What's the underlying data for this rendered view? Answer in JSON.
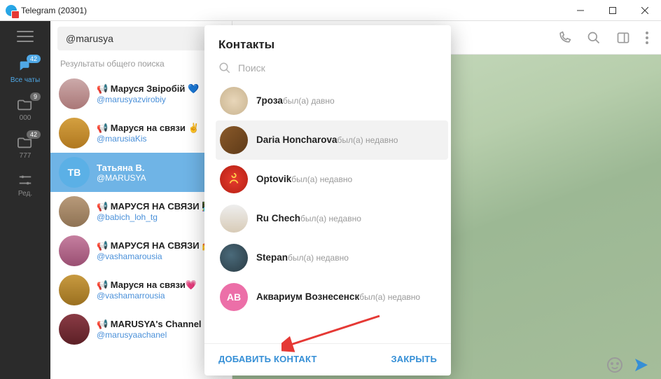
{
  "window": {
    "title": "Telegram (20301)"
  },
  "rail": {
    "items": [
      {
        "label": "Все чаты",
        "badge": "42"
      },
      {
        "label": "000",
        "badge": "9"
      },
      {
        "label": "777",
        "badge": "42"
      },
      {
        "label": "Ред."
      }
    ]
  },
  "search": {
    "value": "@marusya",
    "results_header": "Результаты общего поиска"
  },
  "chats": [
    {
      "name": "📢 Маруся Звіробій 💙",
      "user": "@marusyazvirobiy"
    },
    {
      "name": "📢 Маруся на связи ✌️",
      "user": "@marusiaKis"
    },
    {
      "name": "Татьяна В.",
      "user": "@MARUSYA",
      "selected": true,
      "initials": "ТВ"
    },
    {
      "name": "📢 МАРУСЯ НА СВЯЗИ 👩‍💻",
      "user": "@babich_loh_tg"
    },
    {
      "name": "📢 МАРУСЯ НА СВЯЗИ 💅",
      "user": "@vashamarousia"
    },
    {
      "name": "📢 Маруся на связи💗",
      "user": "@vashamarrousia"
    },
    {
      "name": "📢 MARUSYA's Channel",
      "user": "@marusyaachanel"
    }
  ],
  "modal": {
    "title": "Контакты",
    "search_placeholder": "Поиск",
    "add_label": "ДОБАВИТЬ КОНТАКТ",
    "close_label": "ЗАКРЫТЬ",
    "contacts": [
      {
        "name": "7роза",
        "status": "был(а) давно"
      },
      {
        "name": "Daria Honcharova",
        "status": "был(а) недавно",
        "hover": true
      },
      {
        "name": "Optovik",
        "status": "был(а) недавно"
      },
      {
        "name": "Ru Chech",
        "status": "был(а) недавно"
      },
      {
        "name": "Stepan",
        "status": "был(а) недавно"
      },
      {
        "name": "Аквариум Вознесенск",
        "status": "был(а) недавно",
        "initials": "АВ"
      }
    ]
  }
}
